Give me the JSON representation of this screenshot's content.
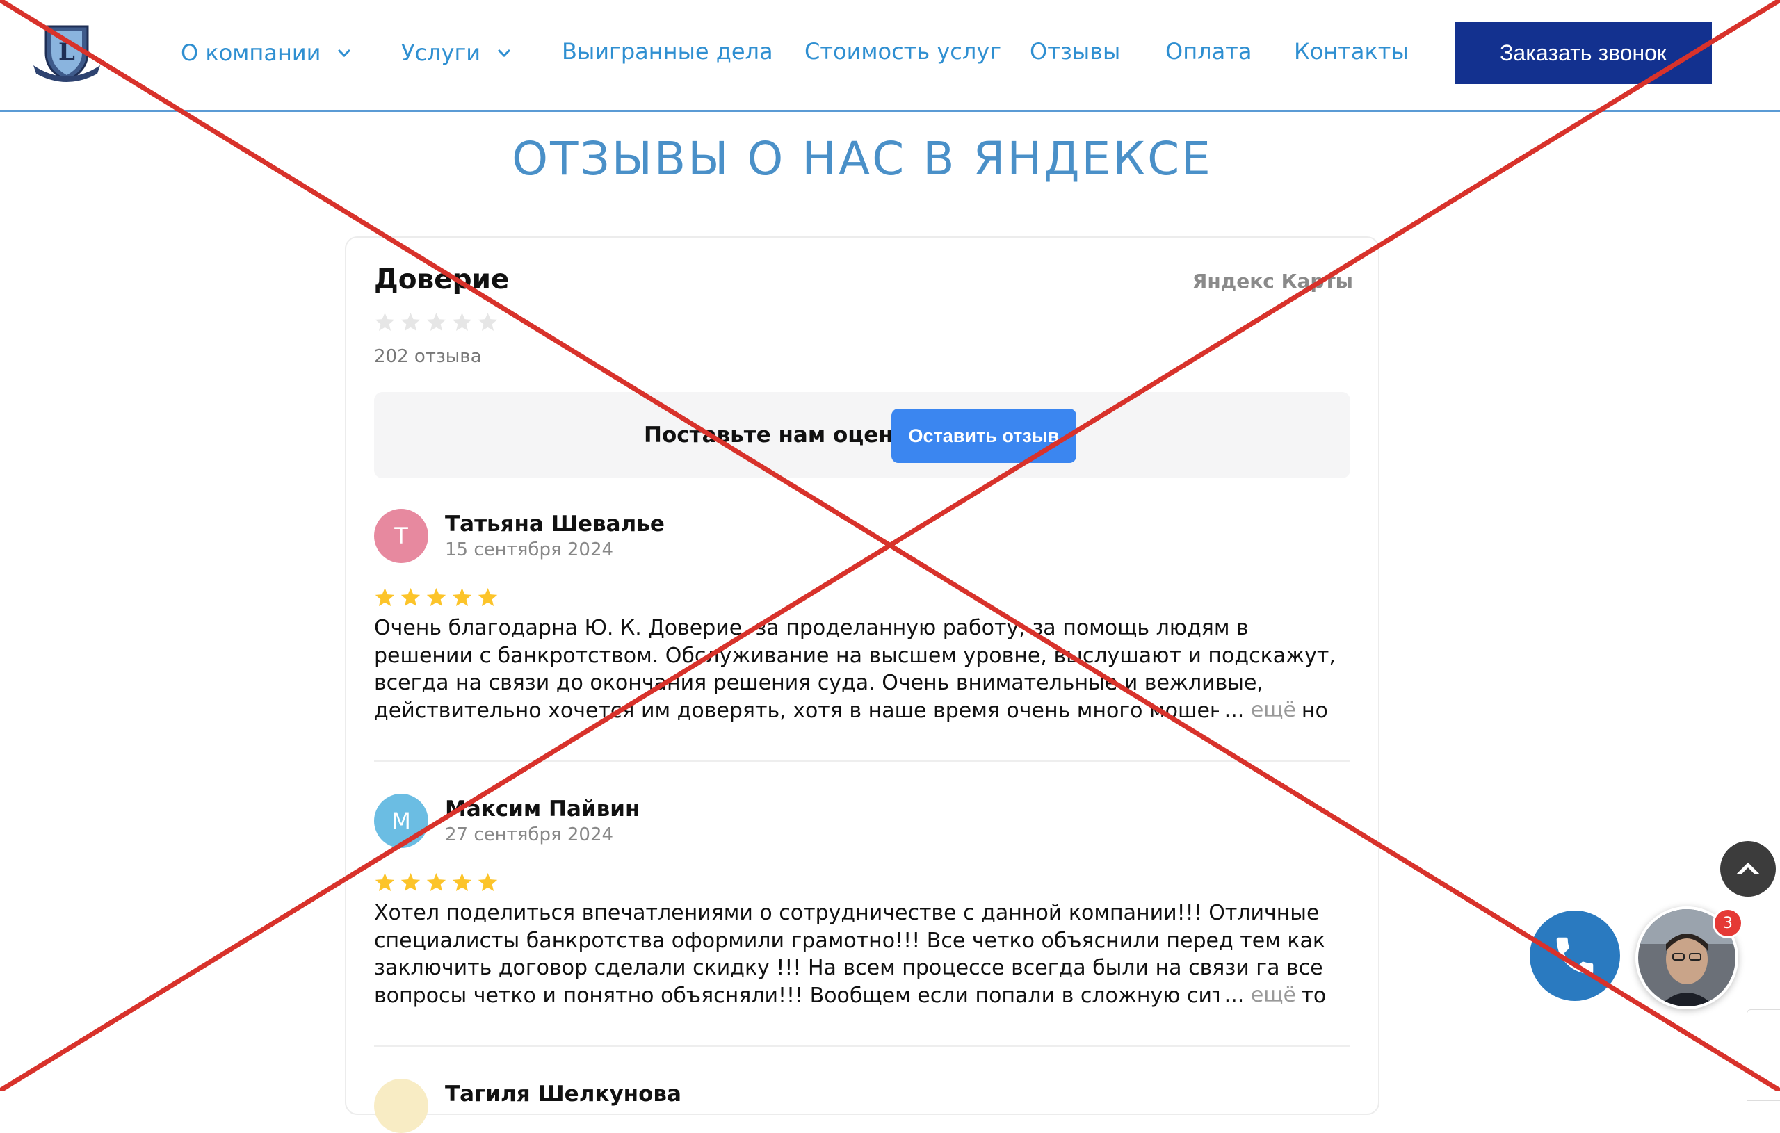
{
  "nav": {
    "items": [
      {
        "label": "О компании",
        "has_dropdown": true
      },
      {
        "label": "Услуги",
        "has_dropdown": true
      },
      {
        "label": "Выигранные дела",
        "has_dropdown": false
      },
      {
        "label": "Стоимость услуг",
        "has_dropdown": false
      },
      {
        "label": "Отзывы",
        "has_dropdown": false
      },
      {
        "label": "Оплата",
        "has_dropdown": false
      },
      {
        "label": "Контакты",
        "has_dropdown": false
      }
    ],
    "cta_label": "Заказать звонок"
  },
  "page": {
    "title": "ОТЗЫВЫ О НАС В ЯНДЕКСЕ"
  },
  "widget": {
    "org_name": "Доверие",
    "source": "Яндекс Карты",
    "rating_stars_filled": 0,
    "review_count": "202 отзыва",
    "rate_prompt": "Поставьте нам оценку",
    "rate_button": "Оставить отзыв",
    "reviews": [
      {
        "initial": "Т",
        "avatar_color": "#e7899f",
        "author": "Татьяна Шевалье",
        "date": "15 сентября 2024",
        "stars": 5,
        "text": "Очень благодарна Ю. К. Доверие, за проделанную работу, за помощь людям в решении с банкротством. Обслуживание на высшем уровне, выслушают и подскажут, всегда на связи до окончания решения суда. Очень внимательные и вежливые, действительно хочется им доверять, хотя в наше время очень много мошенников, но именно они не подведут",
        "more_dots": "...",
        "more_label": "ещё"
      },
      {
        "initial": "М",
        "avatar_color": "#6bbde3",
        "author": "Максим Пайвин",
        "date": "27 сентября 2024",
        "stars": 5,
        "text": "Хотел поделиться впечатлениями о сотрудничестве с данной компании!!! Отличные специалисты банкротства оформили грамотно!!! Все четко объяснили перед тем как заключить договор сделали скидку !!! На всем процессе всегда были на связи га все вопросы четко и понятно объясняли!!! Вообщем если попали в сложную ситуацию то рекомендую вы",
        "more_dots": "...",
        "more_label": "ещё"
      },
      {
        "initial": "",
        "avatar_color": "#f8ecc4",
        "author": "Тагиля Шелкунова",
        "date": "",
        "stars": 0,
        "text": "",
        "more_dots": "",
        "more_label": ""
      }
    ]
  },
  "floating": {
    "chat_badge": "3"
  },
  "colors": {
    "nav_link": "#2f8fd1",
    "cta_bg": "#13318f",
    "title": "#4a90c8",
    "rate_button": "#3b86f0",
    "star_filled": "#fcc42a",
    "star_empty": "#e6e6e6",
    "cross_overlay": "#d8322b"
  }
}
